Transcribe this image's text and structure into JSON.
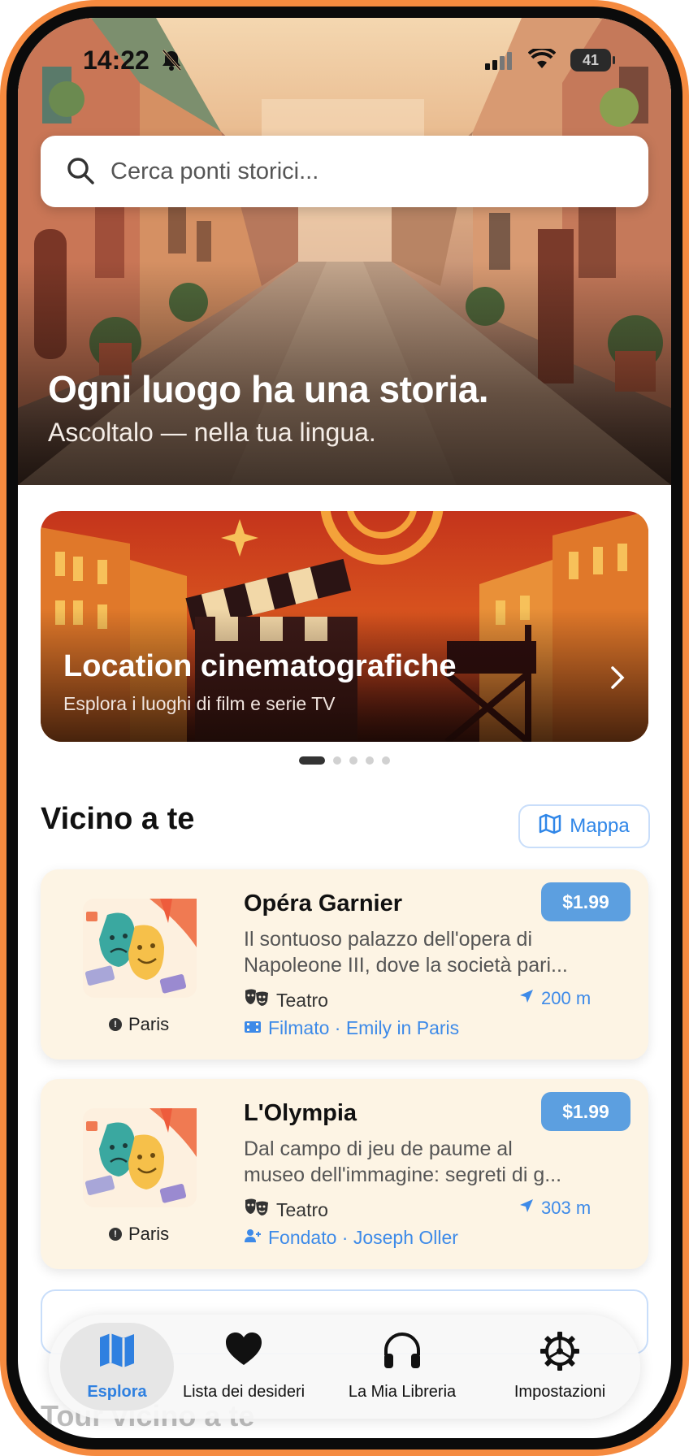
{
  "status_bar": {
    "time": "14:22",
    "battery": "41"
  },
  "search": {
    "placeholder": "Cerca ponti storici..."
  },
  "hero": {
    "title": "Ogni luogo ha una storia.",
    "subtitle": "Ascoltalo — nella tua lingua."
  },
  "banner": {
    "title": "Location cinematografiche",
    "subtitle": "Esplora i luoghi di film e serie TV",
    "page_count": 5,
    "active_page": 1
  },
  "nearby": {
    "title": "Vicino a te",
    "map_button": "Mappa",
    "items": [
      {
        "name": "Opéra Garnier",
        "price": "$1.99",
        "desc_line1": "Il sontuoso palazzo dell'opera di",
        "desc_line2": "Napoleone III, dove la società pari...",
        "category": "Teatro",
        "distance": "200 m",
        "tag": "Filmato · Emily in Paris",
        "city": "Paris"
      },
      {
        "name": "L'Olympia",
        "price": "$1.99",
        "desc_line1": "Dal campo di jeu de paume al",
        "desc_line2": "museo dell'immagine: segreti di g...",
        "category": "Teatro",
        "distance": "303 m",
        "tag": "Fondato · Joseph Oller",
        "city": "Paris"
      }
    ]
  },
  "tours": {
    "title": "Tour vicino a te"
  },
  "tabbar": {
    "items": [
      {
        "label": "Esplora",
        "icon": "map-icon",
        "active": true
      },
      {
        "label": "Lista dei desideri",
        "icon": "heart-icon",
        "active": false
      },
      {
        "label": "La Mia Libreria",
        "icon": "headphones-icon",
        "active": false
      },
      {
        "label": "Impostazioni",
        "icon": "gear-icon",
        "active": false
      }
    ]
  },
  "colors": {
    "accent": "#2f86e8",
    "price_badge": "#5c9fe0",
    "card_bg": "#fdf4e4",
    "frame": "#f58a3f"
  }
}
